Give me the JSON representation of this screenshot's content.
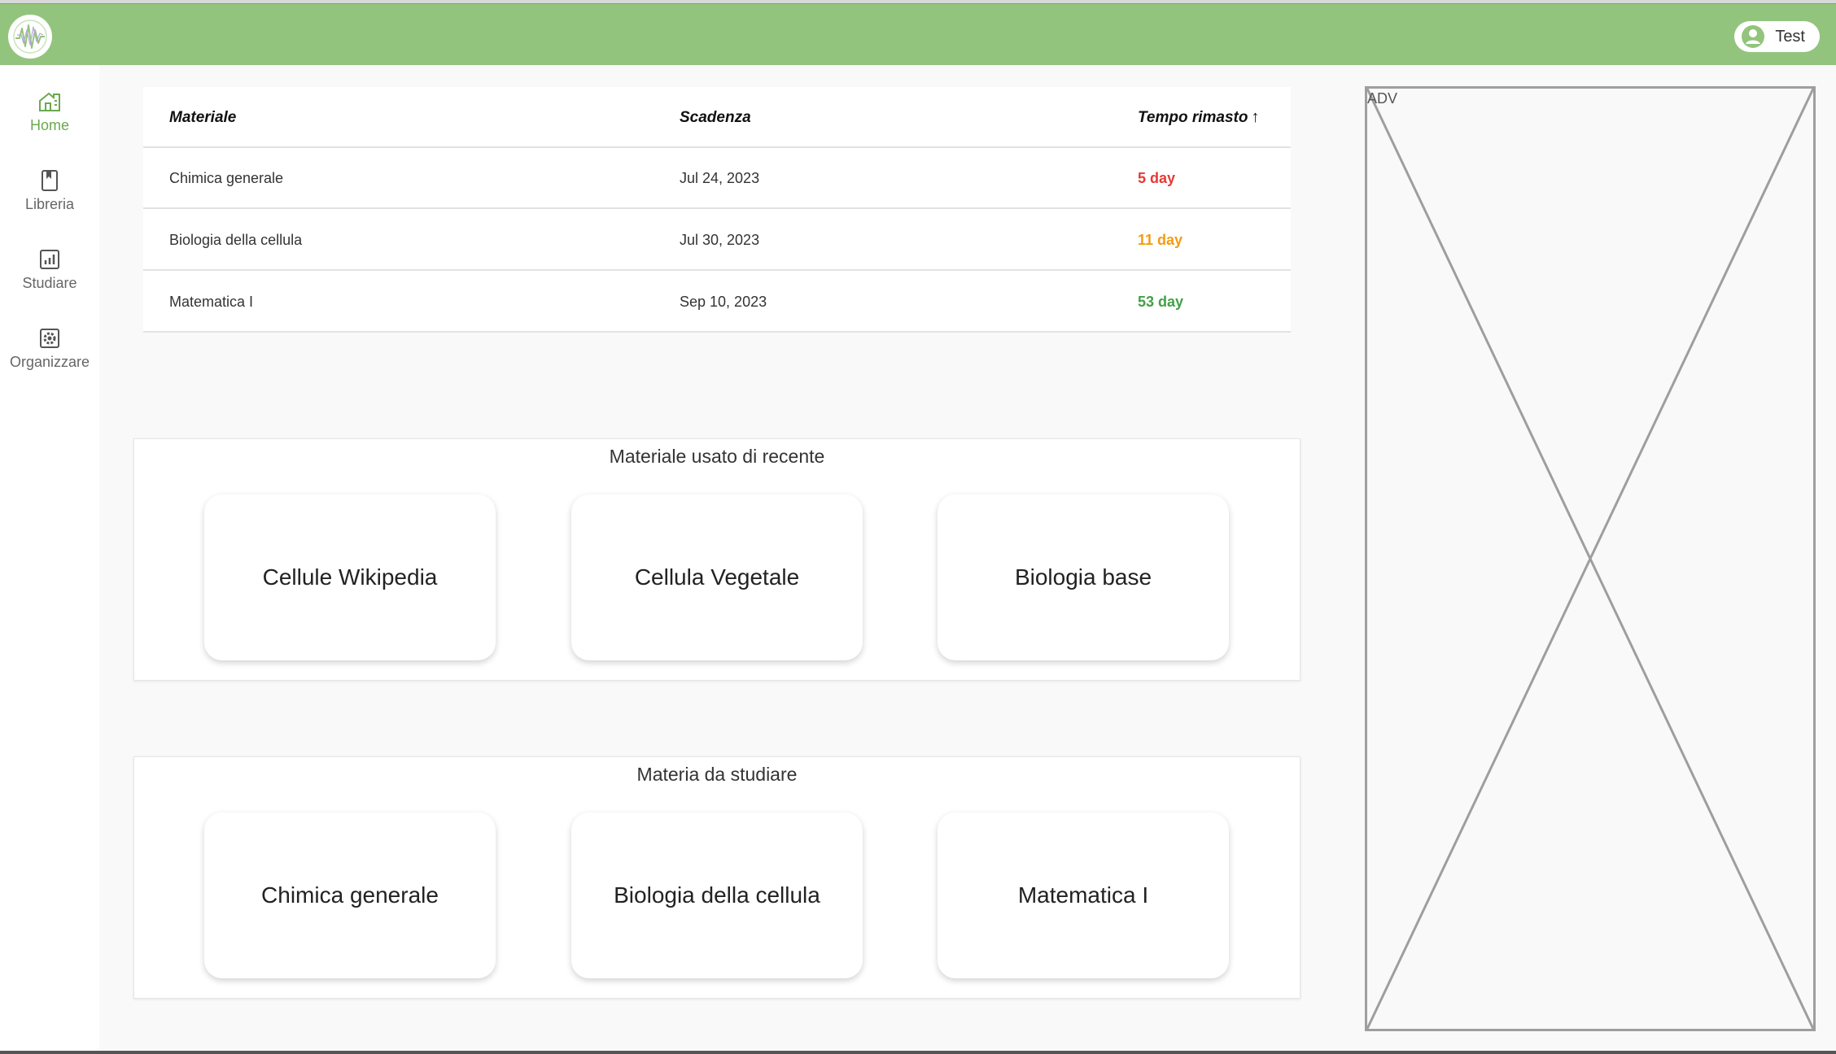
{
  "header": {
    "user_name": "Test",
    "colors": {
      "bar": "#93c47d",
      "accent": "#6aa84f"
    }
  },
  "sidebar": {
    "items": [
      {
        "label": "Home",
        "icon": "home-icon",
        "active": true
      },
      {
        "label": "Libreria",
        "icon": "bookmark-icon",
        "active": false
      },
      {
        "label": "Studiare",
        "icon": "chart-icon",
        "active": false
      },
      {
        "label": "Organizzare",
        "icon": "gear-icon",
        "active": false
      }
    ]
  },
  "deadlines": {
    "headers": {
      "material": "Materiale",
      "due": "Scadenza",
      "remaining": "Tempo rimasto",
      "sort_icon": "↑"
    },
    "rows": [
      {
        "material": "Chimica generale",
        "due": "Jul 24, 2023",
        "remaining": "5 day",
        "color": "#e53935"
      },
      {
        "material": "Biologia della cellula",
        "due": "Jul 30, 2023",
        "remaining": "11 day",
        "color": "#f39c12"
      },
      {
        "material": "Matematica I",
        "due": "Sep 10, 2023",
        "remaining": "53 day",
        "color": "#43a047"
      }
    ]
  },
  "recent": {
    "title": "Materiale usato di recente",
    "items": [
      "Cellule Wikipedia",
      "Cellula Vegetale",
      "Biologia base"
    ]
  },
  "study": {
    "title": "Materia da studiare",
    "items": [
      "Chimica generale",
      "Biologia della cellula",
      "Matematica I"
    ]
  },
  "adv": {
    "label": "ADV"
  }
}
